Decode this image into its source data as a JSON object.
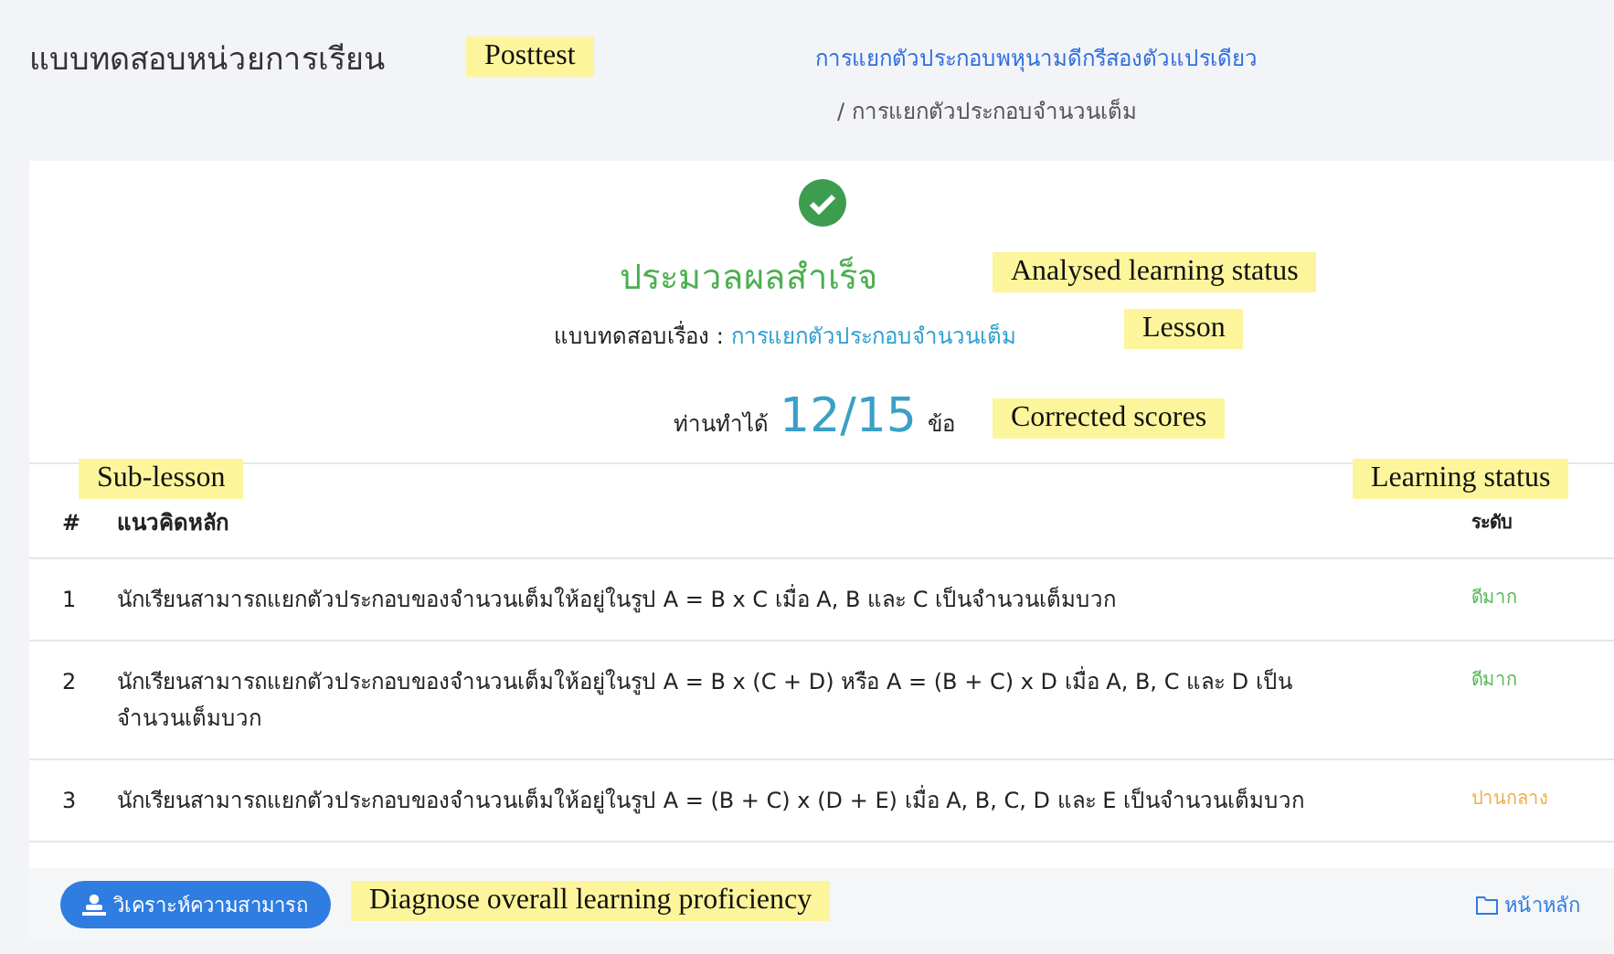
{
  "header": {
    "title": "แบบทดสอบหน่วยการเรียน",
    "breadcrumb": [
      {
        "label": "การแยกตัวประกอบพหุนามดีกรีสองตัวแปรเดียว",
        "kind": "link"
      },
      {
        "label": "/ การแยกตัวประกอบจำนวนเต็ม",
        "kind": "current"
      }
    ]
  },
  "result": {
    "status": "ประมวลผลสำเร็จ",
    "lesson_label": "แบบทดสอบเรื่อง :",
    "lesson": "การแยกตัวประกอบจำนวนเต็ม",
    "score_prefix": "ท่านทำได้",
    "score": "12/15",
    "score_suffix": "ข้อ"
  },
  "table": {
    "columns": [
      "#",
      "แนวคิดหลัก",
      "ระดับ"
    ],
    "rows": [
      {
        "number": "1",
        "concept": "นักเรียนสามารถแยกตัวประกอบของจำนวนเต็มให้อยู่ในรูป A = B x C เมื่อ A, B และ C เป็นจำนวนเต็มบวก",
        "rating": "ดีมาก",
        "color": "#5cb85c"
      },
      {
        "number": "2",
        "concept": "นักเรียนสามารถแยกตัวประกอบของจำนวนเต็มให้อยู่ในรูป  A = B x (C + D) หรือ A = (B + C) x D เมื่อ A, B, C และ D เป็นจำนวนเต็มบวก",
        "rating": "ดีมาก",
        "color": "#5cb85c"
      },
      {
        "number": "3",
        "concept": "นักเรียนสามารถแยกตัวประกอบของจำนวนเต็มให้อยู่ในรูป A = (B + C) x (D + E) เมื่อ A, B, C, D และ E เป็นจำนวนเต็มบวก",
        "rating": "ปานกลาง",
        "color": "#f0ad4e"
      }
    ]
  },
  "footer": {
    "analyze_button": "วิเคราะห์ความสามารถ",
    "home_link": "หน้าหลัก"
  },
  "annotations": [
    "Posttest",
    "Analysed learning status",
    "Lesson",
    "Corrected scores",
    "Sub-lesson",
    "Learning status",
    "Diagnose overall learning proficiency"
  ]
}
